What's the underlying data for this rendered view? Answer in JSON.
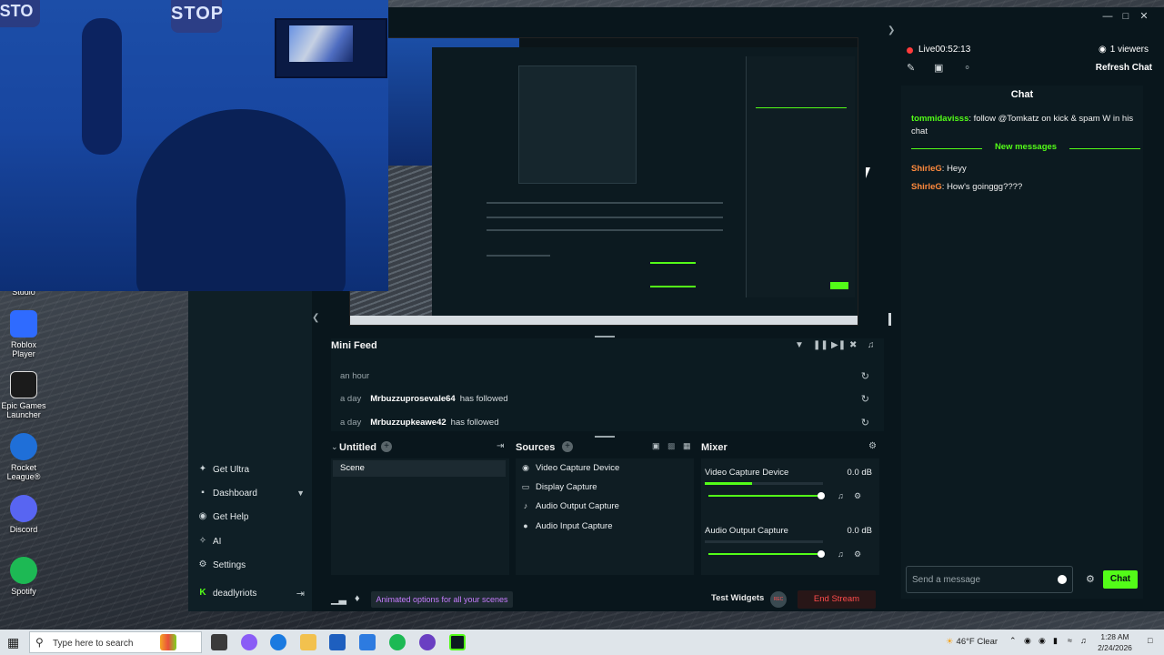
{
  "desktop": {
    "icons": [
      {
        "label": "Studio",
        "icon": "studio-icon"
      },
      {
        "label": "Roblox Player",
        "icon": "roblox-icon",
        "color": "#2f6bff"
      },
      {
        "label": "Epic Games Launcher",
        "icon": "epic-icon",
        "color": "#1b1b1b"
      },
      {
        "label": "Rocket League®",
        "icon": "rocket-league-icon",
        "color": "#1f6fd8"
      },
      {
        "label": "Discord",
        "icon": "discord-icon",
        "color": "#5865f2"
      },
      {
        "label": "Spotify",
        "icon": "spotify-icon",
        "color": "#1db954"
      }
    ]
  },
  "webcam": {
    "sign_text": "STOP",
    "sign_text_left": "STO"
  },
  "app": {
    "nav": {
      "items": [
        {
          "label": "Get Ultra",
          "icon": "ultra-icon"
        },
        {
          "label": "Dashboard",
          "icon": "dashboard-icon"
        },
        {
          "label": "Get Help",
          "icon": "help-icon"
        },
        {
          "label": "AI",
          "icon": "ai-icon"
        },
        {
          "label": "Settings",
          "icon": "settings-icon"
        }
      ],
      "account": "deadlyriots"
    },
    "mini_feed": {
      "title": "Mini Feed",
      "rows": [
        {
          "time": "an hour",
          "user": "",
          "action": ""
        },
        {
          "time": "a day",
          "user": "Mrbuzzuprosevale64",
          "action": "has followed"
        },
        {
          "time": "a day",
          "user": "Mrbuzzupkeawe42",
          "action": "has followed"
        }
      ]
    },
    "scenes": {
      "title": "Untitled",
      "items": [
        "Scene"
      ]
    },
    "sources": {
      "title": "Sources",
      "items": [
        {
          "label": "Video Capture Device",
          "icon": "webcam-icon"
        },
        {
          "label": "Display Capture",
          "icon": "monitor-icon"
        },
        {
          "label": "Audio Output Capture",
          "icon": "speaker-icon"
        },
        {
          "label": "Audio Input Capture",
          "icon": "mic-icon"
        }
      ]
    },
    "mixer": {
      "title": "Mixer",
      "channels": [
        {
          "name": "Video Capture Device",
          "db": "0.0 dB",
          "level": 0.4,
          "volume": 1.0
        },
        {
          "name": "Audio Output Capture",
          "db": "0.0 dB",
          "level": 0.0,
          "volume": 1.0
        }
      ]
    },
    "bottom": {
      "ultra_banner": "Animated options for all your scenes",
      "test_widgets": "Test Widgets",
      "rec": "REC",
      "end_stream": "End Stream"
    },
    "chat_panel": {
      "live_label": "Live",
      "live_time": "00:52:13",
      "viewers": "1 viewers",
      "refresh": "Refresh Chat",
      "title": "Chat",
      "messages_before": [
        {
          "user": "tommidavisss",
          "text": ": follow @Tomkatz on kick & spam W in his chat"
        }
      ],
      "new_messages_label": "New messages",
      "messages_after": [
        {
          "user": "ShirleG",
          "text": ": Heyy"
        },
        {
          "user": "ShirleG",
          "text": ": How's goinggg????"
        }
      ],
      "input_placeholder": "Send a message",
      "send_label": "Chat"
    },
    "accent": "#53fc18"
  },
  "taskbar": {
    "search_placeholder": "Type here to search",
    "weather": "46°F  Clear",
    "time": "1:28 AM",
    "date": "2/24/2026"
  }
}
